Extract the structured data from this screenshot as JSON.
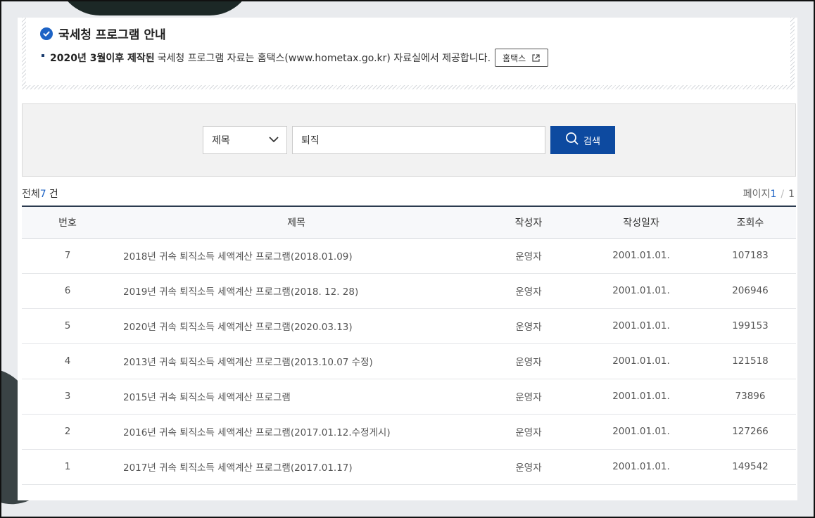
{
  "notice": {
    "title": "국세청 프로그램 안내",
    "line_bold": "2020년 3월이후 제작된",
    "line_text": "국세청 프로그램 자료는 홈택스(www.hometax.go.kr) 자료실에서 제공합니다.",
    "hometax_button": "홈택스"
  },
  "search": {
    "field_selected": "제목",
    "query_value": "퇴직",
    "button_label": "검색"
  },
  "summary": {
    "total_label": "전체",
    "total_count": "7",
    "total_unit": "건",
    "page_label": "페이지",
    "current_page": "1",
    "page_sep": "/",
    "total_pages": "1"
  },
  "table": {
    "headers": [
      "번호",
      "제목",
      "작성자",
      "작성일자",
      "조회수"
    ],
    "rows": [
      {
        "no": "7",
        "title": "2018년 귀속 퇴직소득 세액계산 프로그램(2018.01.09)",
        "writer": "운영자",
        "date": "2001.01.01.",
        "views": "107183"
      },
      {
        "no": "6",
        "title": "2019년 귀속 퇴직소득 세액계산 프로그램(2018. 12. 28)",
        "writer": "운영자",
        "date": "2001.01.01.",
        "views": "206946"
      },
      {
        "no": "5",
        "title": "2020년 귀속 퇴직소득 세액계산 프로그램(2020.03.13)",
        "writer": "운영자",
        "date": "2001.01.01.",
        "views": "199153"
      },
      {
        "no": "4",
        "title": "2013년 귀속 퇴직소득 세액계산 프로그램(2013.10.07 수정)",
        "writer": "운영자",
        "date": "2001.01.01.",
        "views": "121518"
      },
      {
        "no": "3",
        "title": "2015년 귀속 퇴직소득 세액계산 프로그램",
        "writer": "운영자",
        "date": "2001.01.01.",
        "views": "73896"
      },
      {
        "no": "2",
        "title": "2016년 귀속 퇴직소득 세액계산 프로그램(2017.01.12.수정게시)",
        "writer": "운영자",
        "date": "2001.01.01.",
        "views": "127266"
      },
      {
        "no": "1",
        "title": "2017년 귀속 퇴직소득 세액계산 프로그램(2017.01.17)",
        "writer": "운영자",
        "date": "2001.01.01.",
        "views": "149542"
      }
    ]
  },
  "colors": {
    "accent": "#1d63c5",
    "search_button": "#0d4aa0",
    "table_top_border": "#2b3a4f"
  },
  "icons": [
    "check-circle-icon",
    "external-link-icon",
    "chevron-down-icon",
    "search-icon"
  ]
}
